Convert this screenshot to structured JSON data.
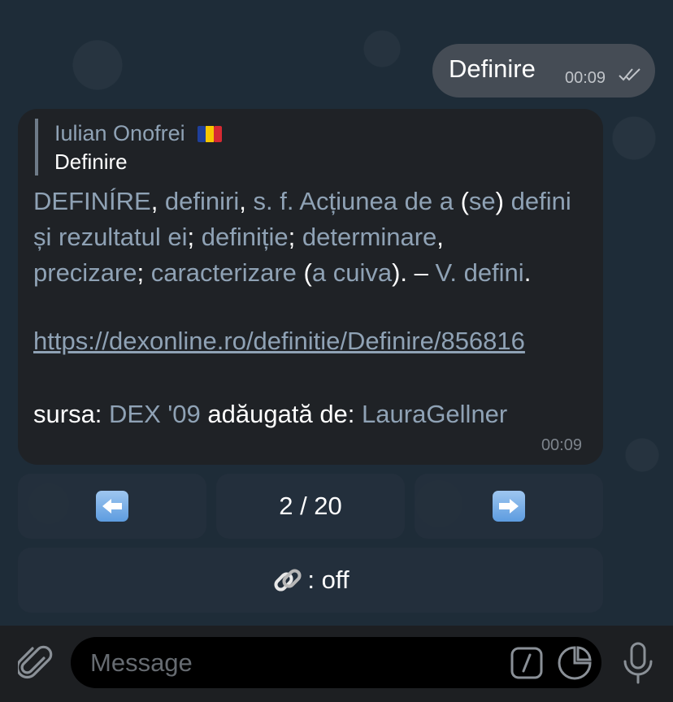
{
  "outgoing": {
    "text": "Definire",
    "time": "00:09"
  },
  "incoming": {
    "reply_to": {
      "name": "Iulian Onofrei",
      "text": "Definire"
    },
    "definition": {
      "headword": "DEFINÍRE",
      "p1": ", ",
      "w1": "definiri",
      "p2": ", ",
      "w2": "s.",
      "p3": " ",
      "w3": "f.",
      "p4": " ",
      "w4": "Acțiunea de a",
      "p5": " (",
      "w5": "se",
      "p6": ") ",
      "w6": "defini și rezultatul ei",
      "p7": "; ",
      "w7": "definiție",
      "p8": "; ",
      "w8": "determinare",
      "p9": ", ",
      "w9": "precizare",
      "p10": "; ",
      "w10": "caracterizare",
      "p11": " (",
      "w11": "a cuiva",
      "p12": "). – ",
      "w12": "V.",
      "p13": " ",
      "w13": "defini",
      "p14": "."
    },
    "url": "https://dexonline.ro/definitie/Definire/856816",
    "source_label": "sursa: ",
    "source_value": "DEX '09",
    "added_label": " adăugată de: ",
    "added_value": "LauraGellner",
    "time": "00:09"
  },
  "keyboard": {
    "prev_icon": "left-arrow-icon",
    "page": "2 / 20",
    "next_icon": "right-arrow-icon",
    "link_toggle_icon": "link-icon",
    "link_toggle_text": ": off"
  },
  "input": {
    "placeholder": "Message",
    "attach_icon": "paperclip-icon",
    "command_icon": "slash-command-icon",
    "sticker_icon": "sticker-icon",
    "mic_icon": "microphone-icon"
  }
}
